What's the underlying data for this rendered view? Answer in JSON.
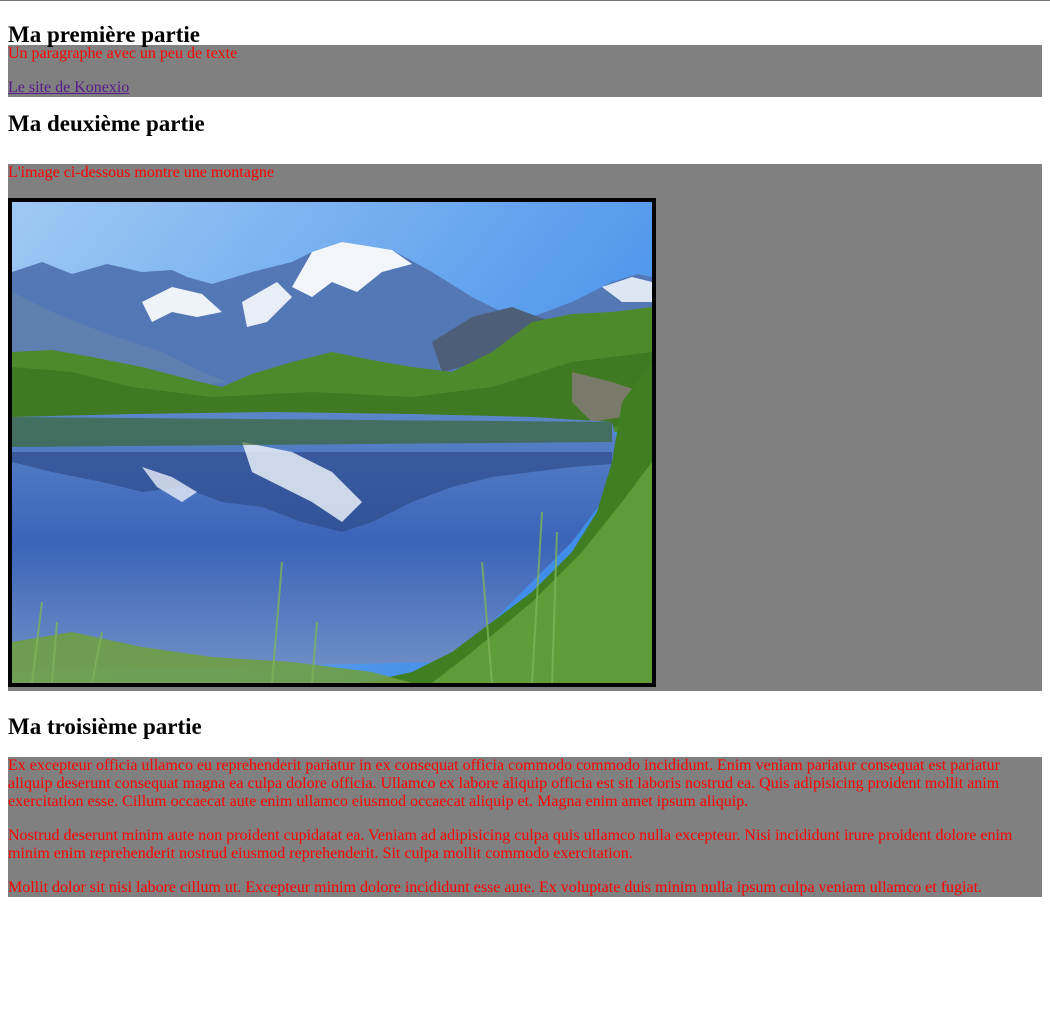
{
  "sections": [
    {
      "heading": "Ma première partie",
      "paragraph": "Un paragraphe avec un peu de texte",
      "link_text": "Le site de Konexio"
    },
    {
      "heading": "Ma deuxième partie",
      "paragraph": "L'image ci-dessous montre une montagne",
      "image": "mountain lake reflection photo"
    },
    {
      "heading": "Ma troisième partie",
      "paragraphs": [
        "Ex excepteur officia ullamco eu reprehenderit pariatur in ex consequat officia commodo commodo incididunt. Enim veniam pariatur consequat est pariatur aliquip deserunt consequat magna ea culpa dolore officia. Ullamco ex labore aliquip officia est sit laboris nostrud ea. Quis adipisicing proident mollit anim exercitation esse. Cillum occaecat aute enim ullamco eiusmod occaecat aliquip et. Magna enim amet ipsum aliquip.",
        "Nostrud deserunt minim aute non proident cupidatat ea. Veniam ad adipisicing culpa quis ullamco nulla excepteur. Nisi incididunt irure proident dolore enim minim enim reprehenderit nostrud eiusmod reprehenderit. Sit culpa mollit commodo exercitation.",
        "Mollit dolor sit nisi labore cillum ut. Excepteur minim dolore incididunt esse aute. Ex voluptate duis minim nulla ipsum culpa veniam ullamco et fugiat."
      ]
    }
  ],
  "colors": {
    "box_background": "#808080",
    "paragraph_text": "#ff0000",
    "link": "#551a8b"
  }
}
